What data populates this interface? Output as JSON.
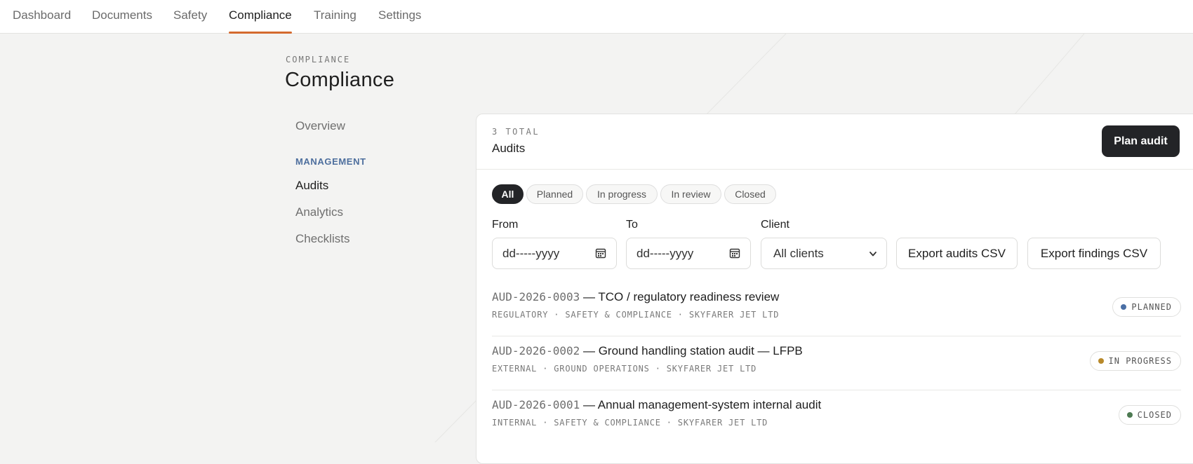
{
  "nav": {
    "tabs": [
      "Dashboard",
      "Documents",
      "Safety",
      "Compliance",
      "Training",
      "Settings"
    ],
    "active": "Compliance"
  },
  "page": {
    "eyebrow": "COMPLIANCE",
    "title": "Compliance"
  },
  "sidebar": {
    "overview": "Overview",
    "section": "MANAGEMENT",
    "items": [
      "Audits",
      "Analytics",
      "Checklists"
    ],
    "active": "Audits"
  },
  "panel": {
    "count": "3 TOTAL",
    "title": "Audits",
    "plan_button": "Plan audit",
    "filters": [
      "All",
      "Planned",
      "In progress",
      "In review",
      "Closed"
    ],
    "active_filter": "All",
    "from_label": "From",
    "from_value": "dd-----yyyy",
    "to_label": "To",
    "to_value": "dd-----yyyy",
    "client_label": "Client",
    "client_value": "All clients",
    "export_audits": "Export audits CSV",
    "export_findings": "Export findings CSV"
  },
  "audits": [
    {
      "code": "AUD-2026-0003",
      "title": "— TCO / regulatory readiness review",
      "meta": "REGULATORY · SAFETY & COMPLIANCE · SKYFARER JET LTD",
      "status": "PLANNED",
      "status_color": "#4a6fa5"
    },
    {
      "code": "AUD-2026-0002",
      "title": "— Ground handling station audit — LFPB",
      "meta": "EXTERNAL · GROUND OPERATIONS · SKYFARER JET LTD",
      "status": "IN PROGRESS",
      "status_color": "#b8892a"
    },
    {
      "code": "AUD-2026-0001",
      "title": "— Annual management-system internal audit",
      "meta": "INTERNAL · SAFETY & COMPLIANCE · SKYFARER JET LTD",
      "status": "CLOSED",
      "status_color": "#4d7a52"
    }
  ],
  "colors": {
    "accent": "#d46a2e",
    "dark": "#232427",
    "section": "#4e6f9e"
  }
}
